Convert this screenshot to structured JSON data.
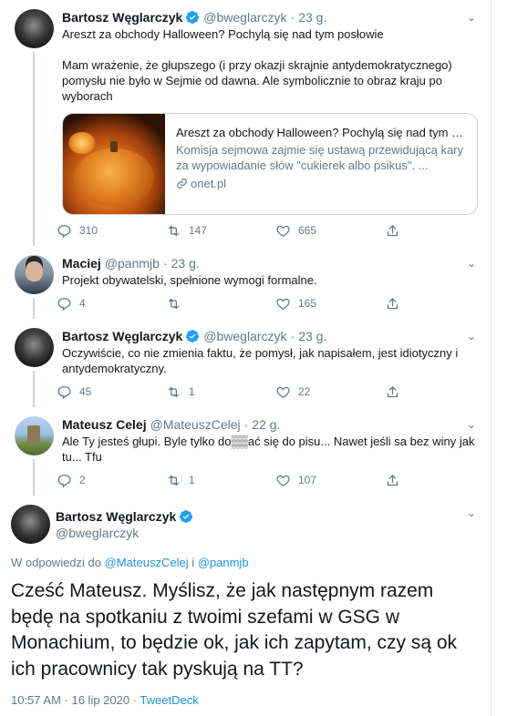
{
  "thread": [
    {
      "name": "Bartosz Węglarczyk",
      "verified": true,
      "handle": "@bweglarczyk",
      "time": "23 g.",
      "paragraphs": [
        "Areszt za obchody Halloween? Pochylą się nad tym posłowie",
        "Mam wrażenie, że głupszego (i przy okazji skrajnie antydemokratycznego) pomysłu nie było w Sejmie od dawna. Ale symbolicznie to obraz kraju po wyborach"
      ],
      "card": {
        "title": "Areszt za obchody Halloween? Pochylą się nad tym p...",
        "description": "Komisja sejmowa zajmie się ustawą przewidującą kary za wypowiadanie słów \"cukierek albo psikus\". ...",
        "domain": "onet.pl"
      },
      "replies": "310",
      "retweets": "147",
      "likes": "665"
    },
    {
      "name": "Maciej",
      "verified": false,
      "handle": "@panmjb",
      "time": "23 g.",
      "paragraphs": [
        "Projekt obywatelski, spełnione wymogi formalne."
      ],
      "replies": "4",
      "retweets": "",
      "likes": "165"
    },
    {
      "name": "Bartosz Węglarczyk",
      "verified": true,
      "handle": "@bweglarczyk",
      "time": "23 g.",
      "paragraphs": [
        "Oczywiście, co nie zmienia faktu, że pomysł, jak napisałem, jest idiotyczny i antydemokratyczny."
      ],
      "replies": "45",
      "retweets": "1",
      "likes": "22"
    },
    {
      "name": "Mateusz Celej",
      "verified": false,
      "handle": "@MateuszCelej",
      "time": "22 g.",
      "paragraphs": [
        "Ale Ty jesteś głupi. Byle tylko do▒▒ać się do pisu... Nawet jeśli sa bez winy jak tu... Tfu"
      ],
      "replies": "2",
      "retweets": "1",
      "likes": "107"
    }
  ],
  "focus": {
    "name": "Bartosz Węglarczyk",
    "handle": "@bweglarczyk",
    "reply_prefix": "W odpowiedzi do",
    "mention_1": "@MateuszCelej",
    "reply_and": "i",
    "mention_2": "@panmjb",
    "text": "Cześć Mateusz. Myślisz, że jak następnym razem będę na spotkaniu z twoimi szefami w GSG w Monachium, to będzie ok, jak ich zapytam, czy są ok ich pracownicy tak pyskują na TT?",
    "timestamp": "10:57 AM · 16 lip 2020 ·",
    "client": "TweetDeck"
  },
  "colors": {
    "accent": "#1b95e0",
    "verified": "#1da1f2",
    "muted": "#657786",
    "divider": "#e6ecf0"
  },
  "icons": [
    "verified-badge-icon",
    "chevron-down-icon",
    "reply-icon",
    "retweet-icon",
    "like-icon",
    "share-icon",
    "link-icon"
  ]
}
